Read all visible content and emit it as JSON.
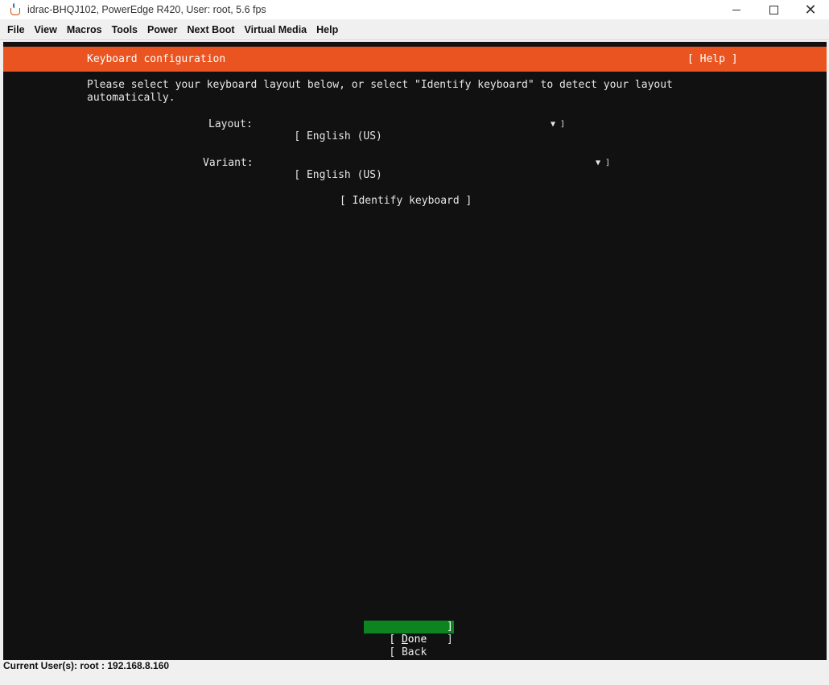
{
  "window": {
    "title": "idrac-BHQJ102, PowerEdge R420, User: root, 5.6 fps",
    "icons": {
      "app": "java-cup-icon",
      "minimize": "minimize-icon",
      "maximize": "maximize-icon",
      "close": "close-icon"
    }
  },
  "menu": [
    "File",
    "View",
    "Macros",
    "Tools",
    "Power",
    "Next Boot",
    "Virtual Media",
    "Help"
  ],
  "console": {
    "header_title": "Keyboard configuration",
    "help_label": "[ Help ]",
    "intro": "Please select your keyboard layout below, or select \"Identify keyboard\" to detect your layout\nautomatically.",
    "layout_label": "Layout:",
    "layout_value": "[ English (US)",
    "variant_label": "Variant:",
    "variant_value": "[ English (US)",
    "arrow_glyph": "▼ ]",
    "identify_label": "[ Identify keyboard ]",
    "done_open": "[ ",
    "done_mnemonic": "D",
    "done_rest": "one",
    "done_close": "]",
    "back_label": "[ Back",
    "back_close": "]",
    "colors": {
      "header": "#e95420",
      "done_bg": "#0e8420",
      "console_bg": "#111111"
    }
  },
  "status": {
    "text": "Current User(s): root : 192.168.8.160"
  }
}
